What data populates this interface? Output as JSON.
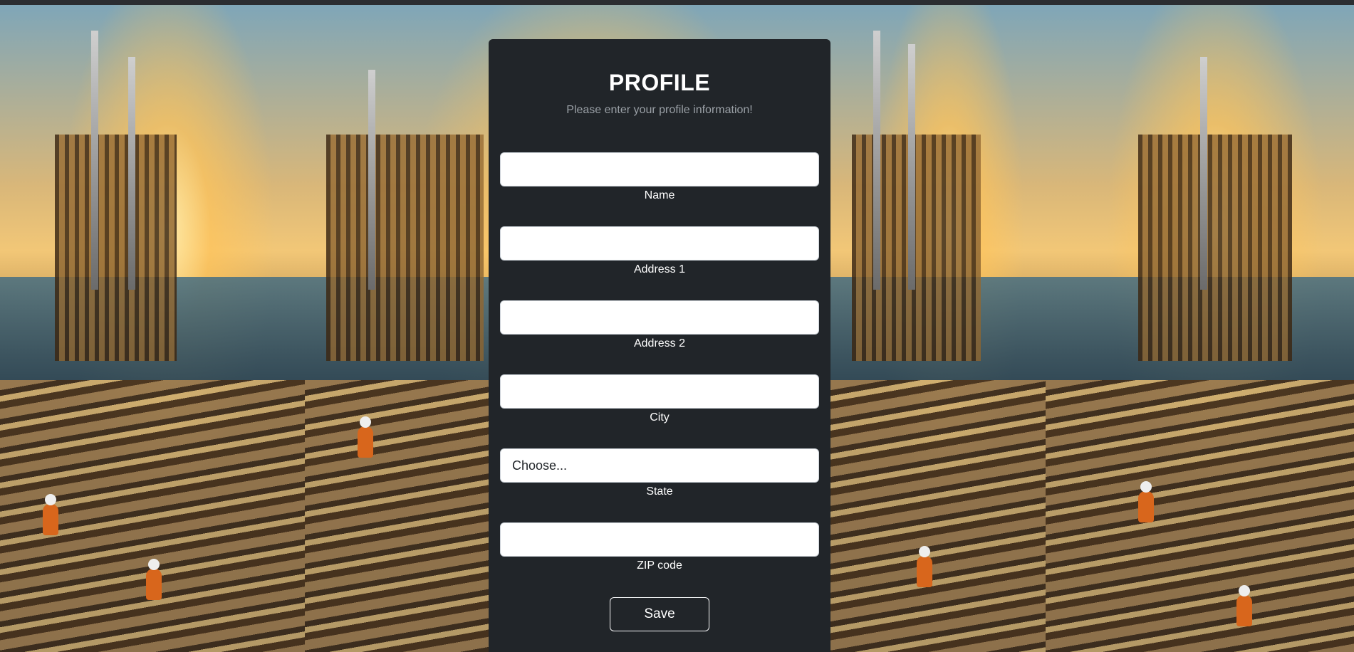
{
  "profile": {
    "title": "PROFILE",
    "subtitle": "Please enter your profile information!",
    "fields": [
      {
        "label": "Name",
        "value": "",
        "type": "text"
      },
      {
        "label": "Address 1",
        "value": "",
        "type": "text"
      },
      {
        "label": "Address 2",
        "value": "",
        "type": "text"
      },
      {
        "label": "City",
        "value": "",
        "type": "text"
      },
      {
        "label": "State",
        "value": "Choose...",
        "type": "select"
      },
      {
        "label": "ZIP code",
        "value": "",
        "type": "text"
      }
    ],
    "save_label": "Save"
  },
  "colors": {
    "panel": "#212529",
    "accent_text": "#ffffff",
    "muted_text": "#9aa0a6"
  }
}
